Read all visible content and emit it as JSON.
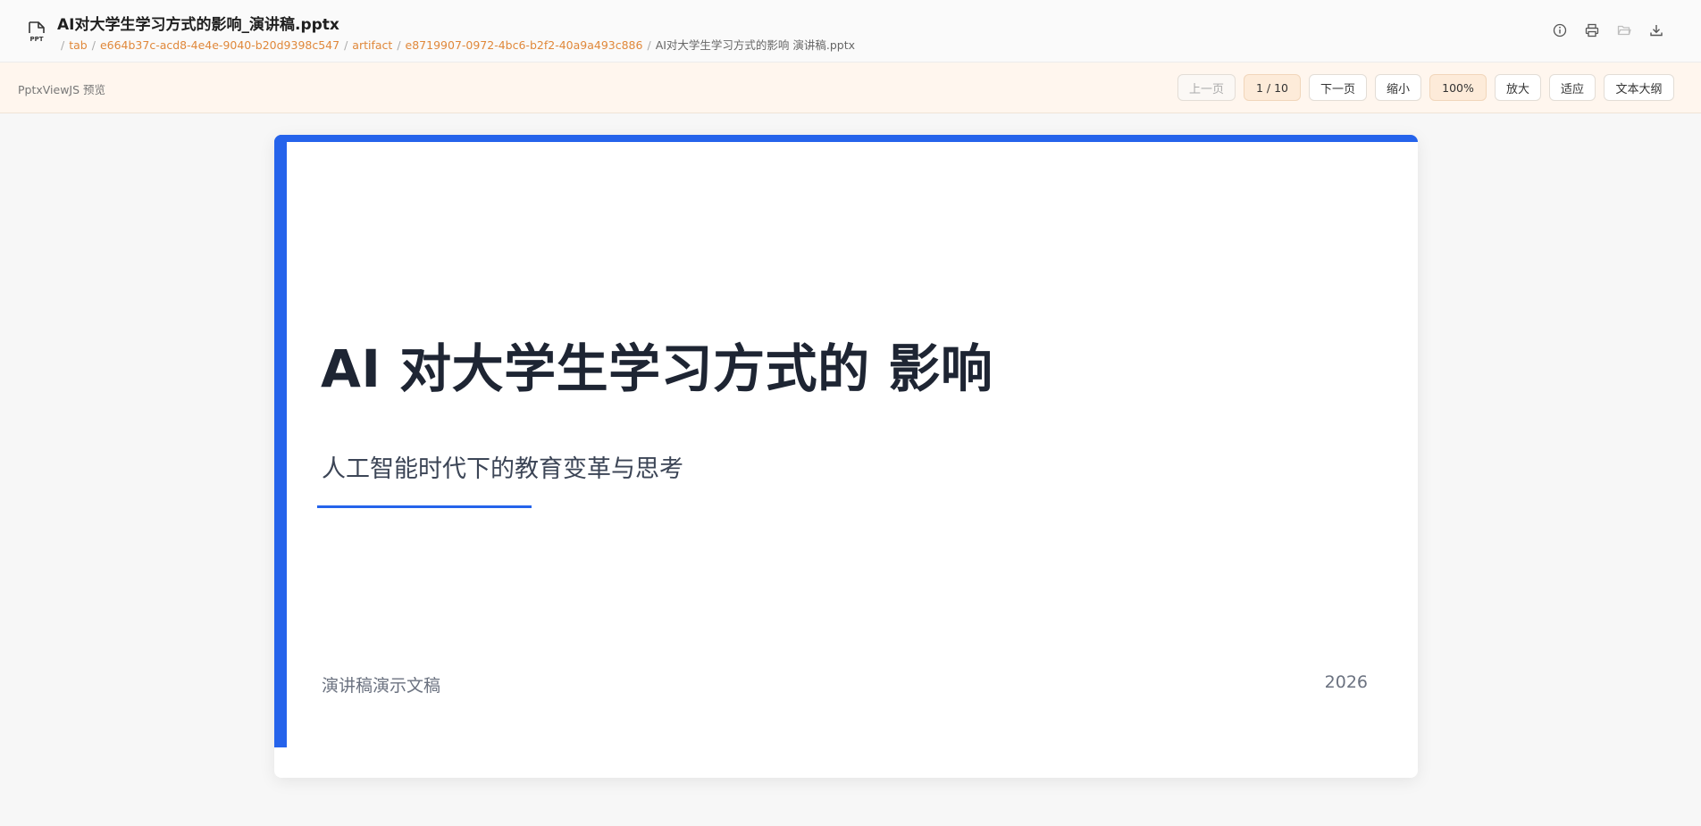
{
  "header": {
    "file_icon": "pptx-file-icon",
    "file_icon_text": "PPT",
    "file_name": "AI对大学生学习方式的影响_演讲稿.pptx",
    "breadcrumb": [
      {
        "label": "tab",
        "link": true
      },
      {
        "label": "e664b37c-acd8-4e4e-9040-b20d9398c547",
        "link": true
      },
      {
        "label": "artifact",
        "link": true
      },
      {
        "label": "e8719907-0972-4bc6-b2f2-40a9a493c886",
        "link": true
      },
      {
        "label": "AI对大学生学习方式的影响 演讲稿.pptx",
        "link": false
      }
    ],
    "actions": [
      "info-icon",
      "print-icon",
      "folder-open-icon",
      "download-icon"
    ]
  },
  "toolbar": {
    "viewer_label": "PptxViewJS 预览",
    "prev_label": "上一页",
    "page_indicator": "1 / 10",
    "next_label": "下一页",
    "zoom_out_label": "缩小",
    "zoom_level": "100%",
    "zoom_in_label": "放大",
    "fit_label": "适应",
    "outline_label": "文本大纲"
  },
  "slide": {
    "title": "AI 对大学生学习方式的 影响",
    "subtitle": "人工智能时代下的教育变革与思考",
    "footer_left": "演讲稿演示文稿",
    "footer_right": "2026",
    "accent_color": "#2563eb"
  }
}
